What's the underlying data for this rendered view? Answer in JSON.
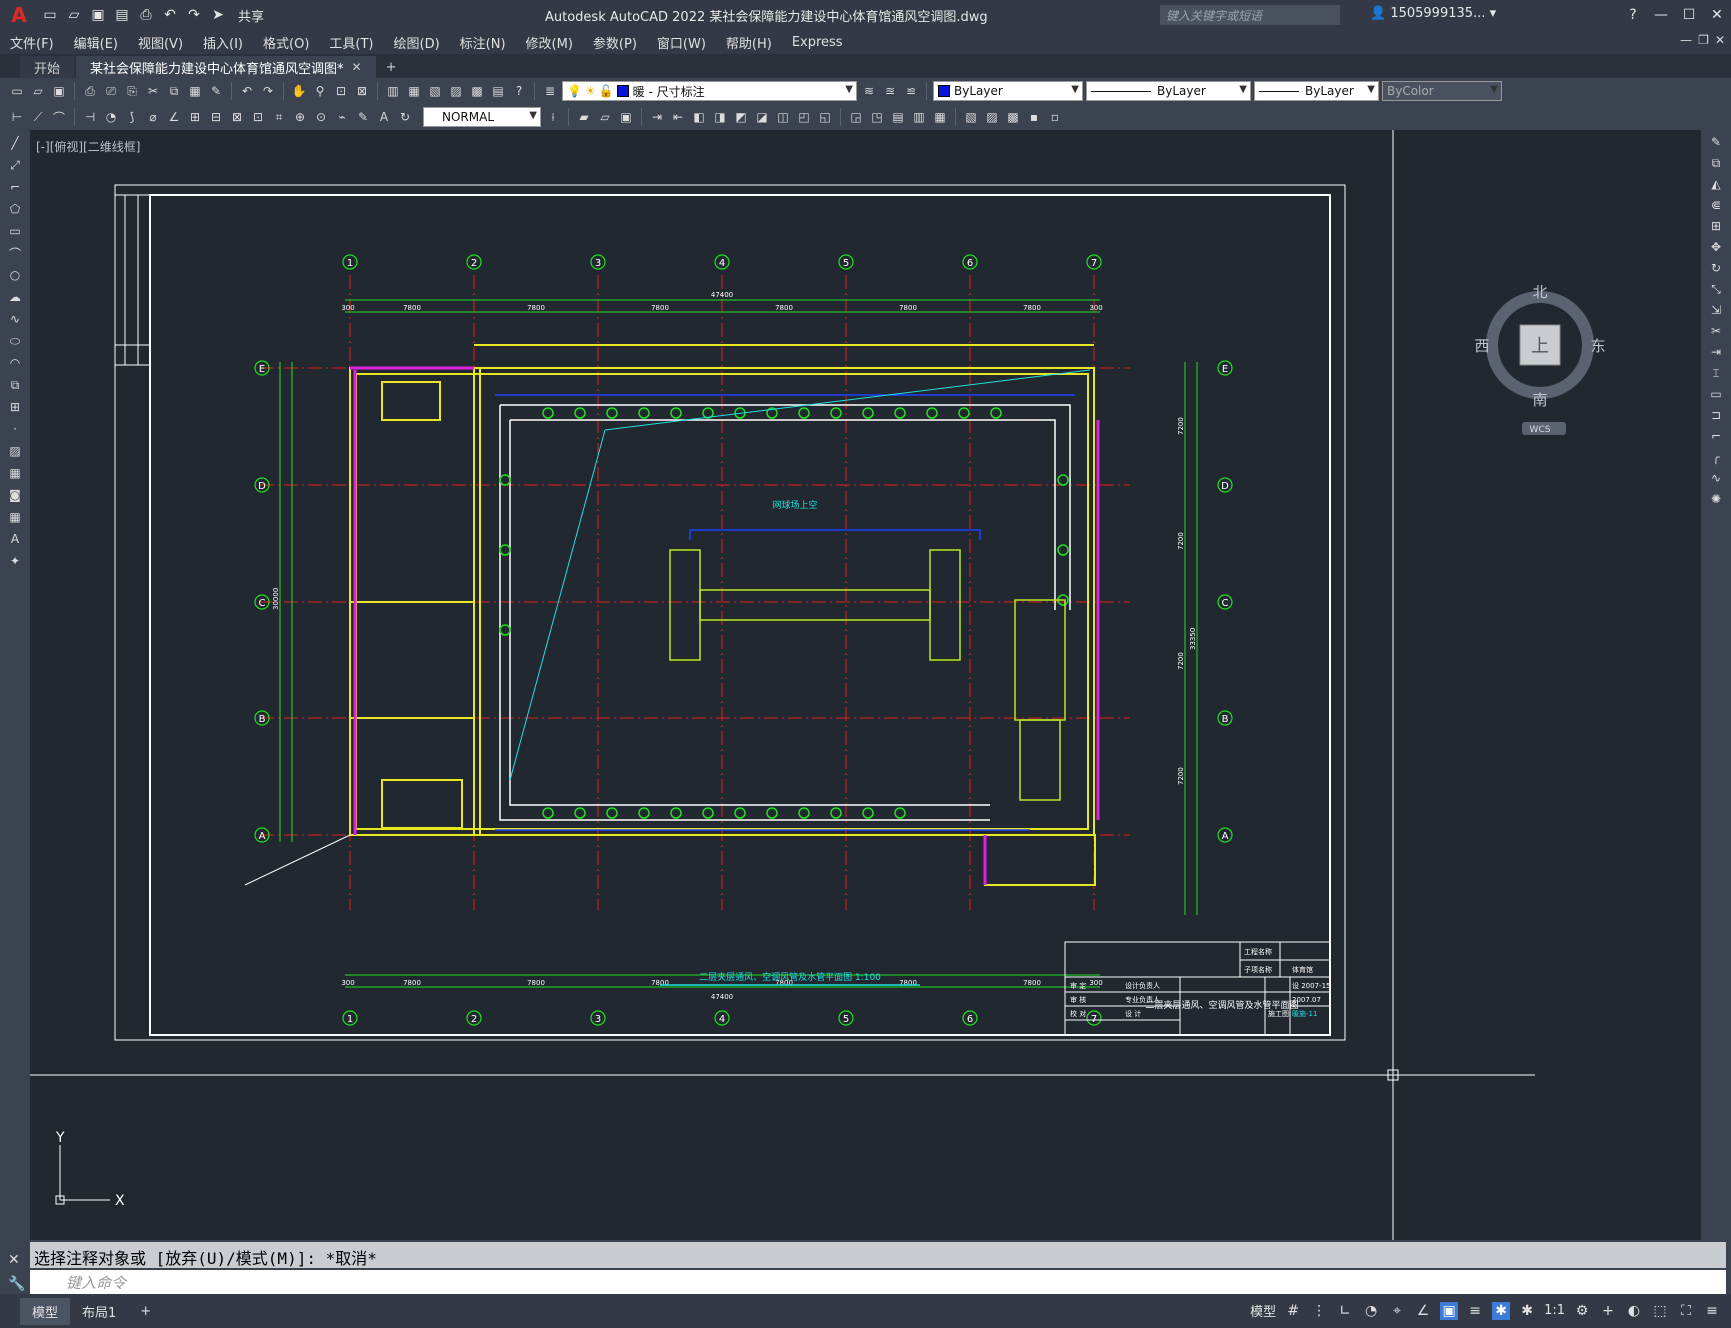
{
  "app": {
    "title": "Autodesk AutoCAD 2022    某社会保障能力建设中心体育馆通风空调图.dwg",
    "logo": "A",
    "share_label": "共享",
    "search_placeholder": "键入关键字或短语",
    "user": "1505999135...",
    "qa_icons": [
      "new-icon",
      "open-icon",
      "save-icon",
      "saveas-icon",
      "plot-icon",
      "undo-icon",
      "redo-icon"
    ]
  },
  "menu": [
    "文件(F)",
    "编辑(E)",
    "视图(V)",
    "插入(I)",
    "格式(O)",
    "工具(T)",
    "绘图(D)",
    "标注(N)",
    "修改(M)",
    "参数(P)",
    "窗口(W)",
    "帮助(H)",
    "Express"
  ],
  "tabs": [
    {
      "label": "开始"
    },
    {
      "label": "某社会保障能力建设中心体育馆通风空调图*"
    }
  ],
  "toolbar": {
    "layer_name": "暖 - 尺寸标注",
    "color": "ByLayer",
    "linetype": "ByLayer",
    "lineweight": "ByLayer",
    "plotstyle": "ByColor",
    "textstyle": "NORMAL"
  },
  "viewport": {
    "label": "[-][俯视][二维线框]",
    "viewcube": {
      "north": "北",
      "south": "南",
      "west": "西",
      "east": "东",
      "face": "上",
      "wcs": "WCS"
    },
    "ucs": {
      "x": "X",
      "y": "Y"
    }
  },
  "drawing": {
    "axis_numbers": [
      "1",
      "2",
      "3",
      "4",
      "5",
      "6",
      "7"
    ],
    "axis_letters": [
      "E",
      "D",
      "C",
      "B",
      "A"
    ],
    "span_dims": [
      "7800",
      "7800",
      "7800",
      "7800",
      "7800",
      "7800"
    ],
    "total_dim": "47400",
    "edge_dim": "300",
    "right_dims": [
      "7200",
      "7200",
      "7200",
      "7200"
    ],
    "right_total": "33350",
    "left_total": "30000",
    "open_label": "网球场上空",
    "sheet_title": "二层夹层通风、空调风管及水管平面图 1:100",
    "title_block": {
      "project_label": "工程名称",
      "item_label": "子项名称",
      "item_value": "体育馆",
      "drawing_name": "二层夹层通风、空调风管及水管平面图",
      "drawing_no": "暖施-11",
      "design_no": "设 2007-15",
      "date": "2007.07",
      "stage": "施工图",
      "roles": [
        "审 定",
        "审 核",
        "校 对",
        "设计负责人",
        "专业负责人",
        "设 计"
      ]
    }
  },
  "command": {
    "history": "选择注释对象或 [放弃(U)/模式(M)]: *取消*",
    "placeholder": "键入命令"
  },
  "status": {
    "tabs": [
      "模型",
      "布局1"
    ],
    "model_label": "模型",
    "scale": "1:1"
  }
}
